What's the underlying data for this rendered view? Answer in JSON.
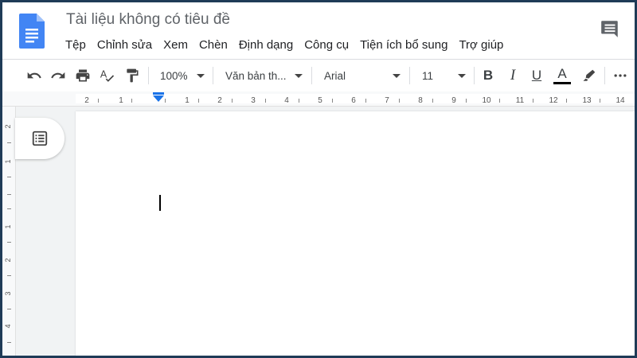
{
  "header": {
    "title": "Tài liệu không có tiêu đề",
    "logo_icon": "google-docs-icon",
    "comment_icon": "comment-icon"
  },
  "menu": {
    "items": [
      "Tệp",
      "Chỉnh sửa",
      "Xem",
      "Chèn",
      "Định dạng",
      "Công cụ",
      "Tiện ích bổ sung",
      "Trợ giúp"
    ]
  },
  "toolbar": {
    "undo_icon": "undo-icon",
    "redo_icon": "redo-icon",
    "print_icon": "print-icon",
    "spellcheck_icon": "spellcheck-icon",
    "paint_format_icon": "paint-format-icon",
    "zoom": "100%",
    "style": "Văn bản th...",
    "font": "Arial",
    "font_size": "11",
    "bold": "B",
    "italic": "I",
    "underline": "U",
    "text_color": "A",
    "highlight_icon": "highlighter-icon",
    "more_icon": "more-icon"
  },
  "ruler": {
    "labels": [
      "2",
      "1",
      "1",
      "2",
      "3",
      "4",
      "5",
      "6",
      "7",
      "8",
      "9",
      "10",
      "11",
      "12",
      "13",
      "14"
    ]
  },
  "vertical_ruler": {
    "labels": [
      "2",
      "1",
      "1",
      "2",
      "3",
      "4"
    ]
  },
  "outline": {
    "icon": "document-outline-icon"
  },
  "colors": {
    "accent": "#1a73e8",
    "doc_blue": "#4285f4",
    "frame_border": "#1f3b57",
    "text_gray": "#5f6368"
  }
}
